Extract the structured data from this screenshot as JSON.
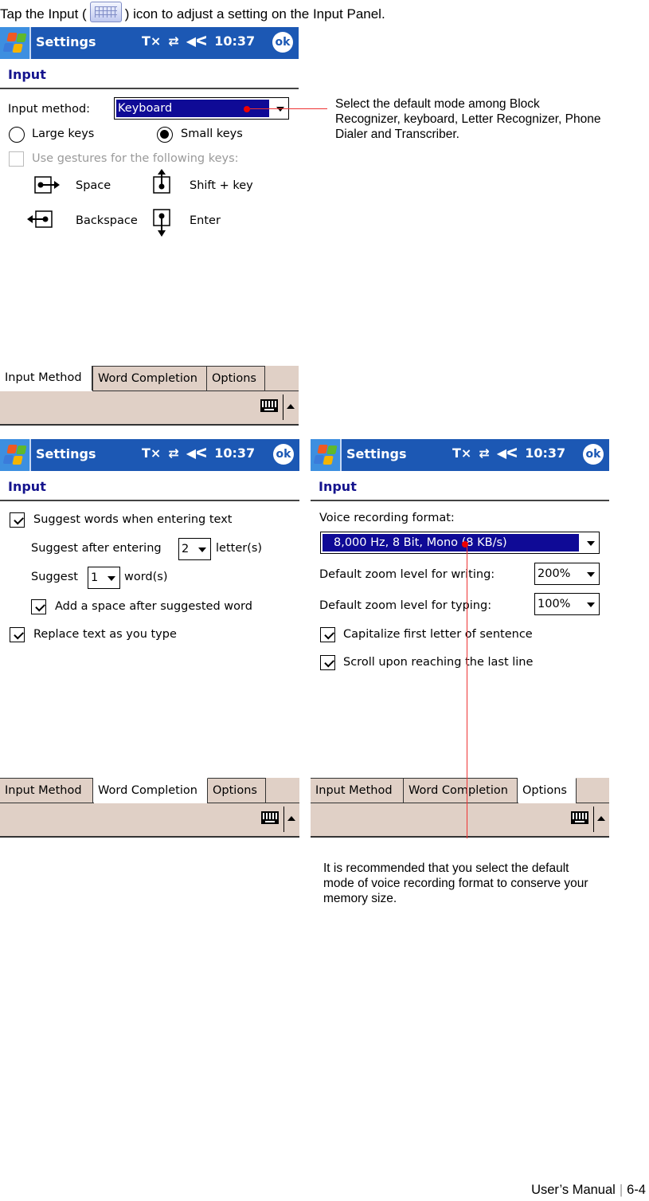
{
  "intro": {
    "before": "Tap the Input (",
    "icon": "keyboard-icon",
    "after": ") icon to adjust a setting on the Input Panel."
  },
  "common": {
    "app_title": "Settings",
    "status_icons": [
      "antenna-off-icon",
      "connectivity-icon",
      "speaker-icon"
    ],
    "time": "10:37",
    "ok_label": "ok",
    "page_header": "Input",
    "tabs": [
      "Input Method",
      "Word Completion",
      "Options"
    ],
    "menubar_icons": [
      "keyboard-icon",
      "sip-up-arrow-icon"
    ]
  },
  "screen1": {
    "active_tab": "Input Method",
    "input_method_label": "Input method:",
    "input_method_value": "Keyboard",
    "radio_large": "Large keys",
    "radio_small": "Small keys",
    "selected_key_size": "Small keys",
    "gestures_label": "Use gestures for the following keys:",
    "gestures_checked": false,
    "gestures_enabled": false,
    "gestures": [
      {
        "icon": "space-gesture-icon",
        "label": "Space"
      },
      {
        "icon": "shift-gesture-icon",
        "label": "Shift + key"
      },
      {
        "icon": "backspace-gesture-icon",
        "label": "Backspace"
      },
      {
        "icon": "enter-gesture-icon",
        "label": "Enter"
      }
    ]
  },
  "screen2": {
    "active_tab": "Word Completion",
    "suggest_words": {
      "label": "Suggest words when entering text",
      "checked": true
    },
    "suggest_after_label": "Suggest after entering",
    "suggest_after_value": "2",
    "suggest_after_unit": "letter(s)",
    "suggest_label": "Suggest",
    "suggest_value": "1",
    "suggest_unit": "word(s)",
    "add_space": {
      "label": "Add a space after suggested word",
      "checked": true
    },
    "replace_text": {
      "label": "Replace text as you type",
      "checked": true
    }
  },
  "screen3": {
    "active_tab": "Options",
    "voice_format_label": "Voice recording format:",
    "voice_format_value": "8,000 Hz, 8 Bit, Mono (8 KB/s)",
    "zoom_writing_label": "Default zoom level for writing:",
    "zoom_writing_value": "200%",
    "zoom_typing_label": "Default zoom level for typing:",
    "zoom_typing_value": "100%",
    "capitalize": {
      "label": "Capitalize first letter of sentence",
      "checked": true
    },
    "scroll": {
      "label": "Scroll upon reaching the last line",
      "checked": true
    }
  },
  "callouts": {
    "input_method": "Select the default mode among Block Recognizer, keyboard, Letter Recognizer, Phone Dialer and Transcriber.",
    "voice_format": "It is recommended that you select the default mode of voice recording format to conserve your memory size."
  },
  "colors": {
    "titlebar": "#1c58b4",
    "selection": "#0f0a96",
    "header_text": "#15148e",
    "tab_bg": "#e0d0c6",
    "callout_line": "#ee3333"
  },
  "footer": {
    "manual": "User’s Manual",
    "page": "6-4"
  }
}
